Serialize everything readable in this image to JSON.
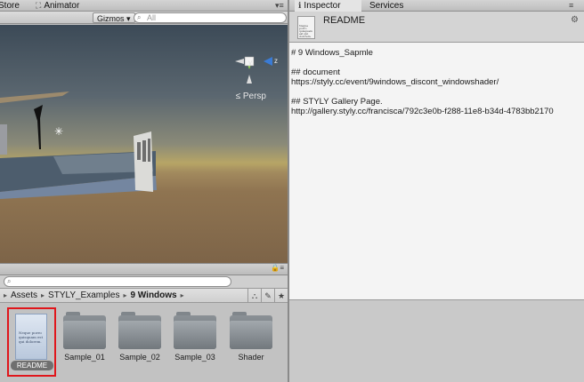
{
  "left_tabs": [
    {
      "label": "Store",
      "icon": "store-icon"
    },
    {
      "label": "Animator",
      "icon": "animator-icon"
    }
  ],
  "scene": {
    "gizmos_label": "Gizmos",
    "search_placeholder": "All",
    "persp_label": "Persp",
    "axes": {
      "y": "y",
      "z": "z"
    }
  },
  "project": {
    "breadcrumb": [
      "Assets",
      "STYLY_Examples",
      "9 Windows"
    ],
    "assets": [
      {
        "label": "README",
        "kind": "document",
        "selected": true,
        "doc_text": "Neque porro quisquam est qui dolorem."
      },
      {
        "label": "Sample_01",
        "kind": "folder"
      },
      {
        "label": "Sample_02",
        "kind": "folder"
      },
      {
        "label": "Sample_03",
        "kind": "folder"
      },
      {
        "label": "Shader",
        "kind": "folder"
      }
    ]
  },
  "right_tabs": [
    {
      "label": "Inspector",
      "icon": "info-icon",
      "active": true
    },
    {
      "label": "Services",
      "active": false
    }
  ],
  "inspector": {
    "title": "README",
    "doc_icon_text": "Neque porro quisquam est qui dolorem.",
    "lines": [
      "# 9 Windows_Sapmle",
      "",
      "## document",
      "https://styly.cc/event/9windows_discont_windowshader/",
      "",
      "## STYLY Gallery Page.",
      "http://gallery.styly.cc/francisca/792c3e0b-f288-11e8-b34d-4783bb2170"
    ]
  },
  "colors": {
    "selection_outline": "#e0161b",
    "gizmo_y": "#8fd14f",
    "gizmo_z": "#3a7bd5"
  }
}
